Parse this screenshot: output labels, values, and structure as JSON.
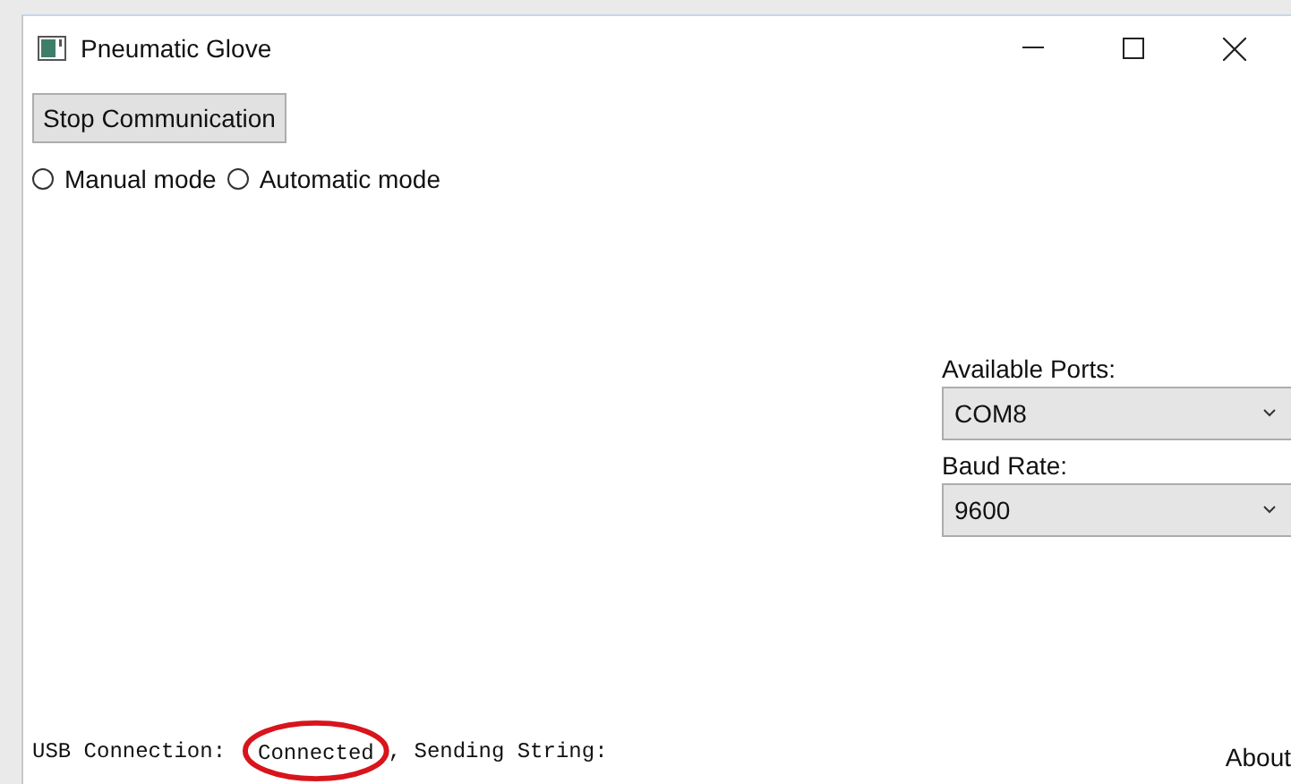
{
  "window": {
    "title": "Pneumatic Glove"
  },
  "stop_button": {
    "label": "Stop Communication"
  },
  "modes": [
    {
      "label": "Manual mode",
      "selected": false
    },
    {
      "label": "Automatic mode",
      "selected": false
    }
  ],
  "ports": {
    "label": "Available Ports:",
    "value": "COM8"
  },
  "baud": {
    "label": "Baud Rate:",
    "value": "9600"
  },
  "status": {
    "prefix": "USB Connection:",
    "state": "Connected",
    "suffix": ", Sending String:"
  },
  "about": "About"
}
